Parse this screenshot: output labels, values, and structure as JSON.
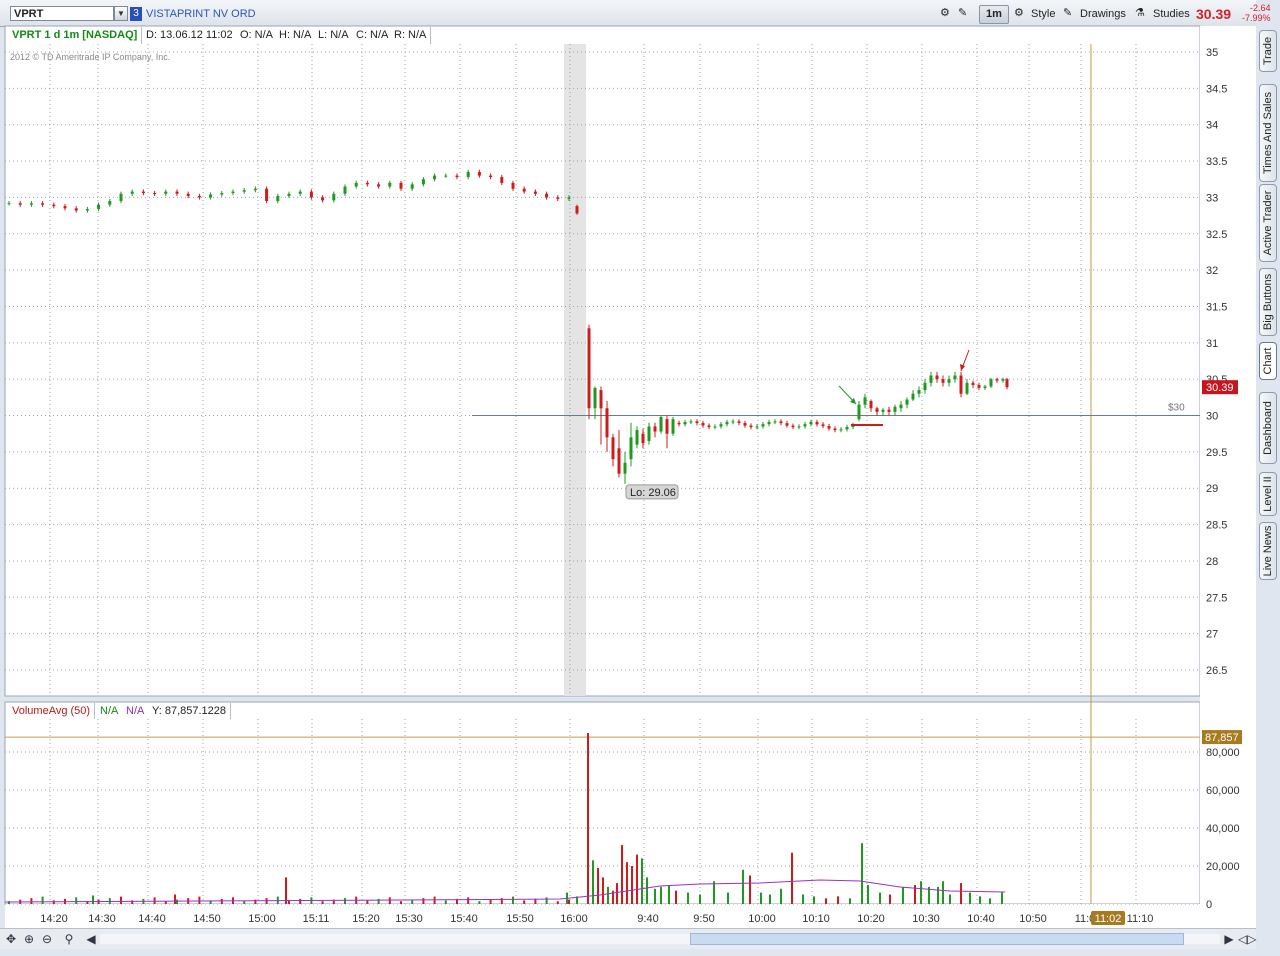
{
  "toolbar": {
    "symbol": "VPRT",
    "link_number": "3",
    "description": "VISTAPRINT NV ORD",
    "timeframe": "1m",
    "style_label": "Style",
    "drawings_label": "Drawings",
    "studies_label": "Studies",
    "last_price": "30.39",
    "net_change": "-2.64",
    "pct_change": "-7.99%"
  },
  "side_tabs": [
    "Trade",
    "Times And Sales",
    "Active Trader",
    "Big Buttons",
    "Chart",
    "Dashboard",
    "Level II",
    "Live News"
  ],
  "price_header": {
    "title": "VPRT 1 d 1m [NASDAQ]",
    "date": "D: 13.06.12 11:02",
    "open": "O: N/A",
    "high": "H: N/A",
    "low": "L: N/A",
    "close": "C: N/A",
    "range": "R: N/A"
  },
  "copyright": "2012 © TD Ameritrade IP Company, Inc.",
  "volume_header": {
    "study": "VolumeAvg (50)",
    "v1": "N/A",
    "v2": "N/A",
    "y": "Y: 87,857.1228"
  },
  "labels": {
    "low_bubble": "Lo: 29.06",
    "price_line": "$30",
    "last_tag": "30.39",
    "vol_tag": "87,857",
    "time_tag": "11:02"
  },
  "colors": {
    "up": "#1f9a1f",
    "down": "#d11a1a",
    "grid": "#9aa3ad",
    "avg": "#9b30c8",
    "orange": "#c89b4a"
  },
  "chart_data": {
    "type": "candlestick",
    "ticker": "VPRT",
    "price_axis": {
      "ticks": [
        "35",
        "34.5",
        "34",
        "33.5",
        "33",
        "32.5",
        "32",
        "31.5",
        "31",
        "30.5",
        "30",
        "29.5",
        "29",
        "28.5",
        "28",
        "27.5",
        "27",
        "26.5"
      ],
      "range": [
        26.2,
        35.1
      ]
    },
    "volume_axis": {
      "ticks": [
        "80,000",
        "60,000",
        "40,000",
        "20,000",
        "0"
      ],
      "range": [
        0,
        90000
      ]
    },
    "time_ticks": [
      "14:20",
      "14:30",
      "14:40",
      "14:50",
      "15:00",
      "15:11",
      "15:20",
      "15:30",
      "15:40",
      "15:50",
      "16:00",
      "9:40",
      "9:50",
      "10:00",
      "10:10",
      "10:20",
      "10:30",
      "10:40",
      "10:50",
      "11:0",
      "11:10"
    ],
    "horizontal_line": 30,
    "low": 29.06,
    "last": 30.39,
    "volume_avg_y": 87857.1228,
    "volume_spikes": [
      {
        "time": "9:31",
        "volume": 90000
      },
      {
        "time": "10:19",
        "volume": 32000
      },
      {
        "time": "10:07",
        "volume": 27000
      },
      {
        "time": "15:02",
        "volume": 14000
      }
    ]
  }
}
